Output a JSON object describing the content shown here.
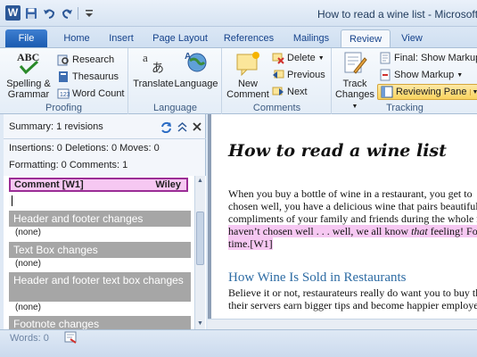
{
  "titlebar": {
    "title": "How to read a wine list - Microsoft W"
  },
  "tabs": [
    "File",
    "Home",
    "Insert",
    "Page Layout",
    "References",
    "Mailings",
    "Review",
    "View"
  ],
  "ribbon": {
    "proofing": {
      "label": "Proofing",
      "spelling": "Spelling & Grammar",
      "research": "Research",
      "thesaurus": "Thesaurus",
      "word_count": "Word Count"
    },
    "language": {
      "label": "Language",
      "translate": "Translate",
      "language": "Language"
    },
    "comments": {
      "label": "Comments",
      "new_comment": "New Comment",
      "delete": "Delete",
      "previous": "Previous",
      "next": "Next"
    },
    "tracking": {
      "label": "Tracking",
      "track_changes": "Track Changes",
      "final_markup": "Final: Show Markup",
      "show_markup": "Show Markup",
      "reviewing_pane": "Reviewing Pane"
    }
  },
  "summary": {
    "title": "Summary: 1 revisions",
    "line1": "Insertions: 0  Deletions: 0  Moves: 0",
    "line2": "Formatting: 0  Comments: 1",
    "comment_label": "Comment [W1]",
    "comment_author": "Wiley",
    "sections": [
      {
        "title": "Header and footer changes",
        "value": "(none)"
      },
      {
        "title": "Text Box changes",
        "value": "(none)"
      },
      {
        "title": "Header and footer text box changes",
        "value": "(none)"
      },
      {
        "title": "Footnote changes",
        "value": ""
      }
    ]
  },
  "document": {
    "heading": "How to read a wine list",
    "p1": "When you buy a bottle of wine in a restaurant, you get to",
    "p2": "chosen well, you have a delicious wine that pairs beautifull",
    "p3": "compliments of your family and friends during the whole m",
    "p4a": "haven’t chosen well . . . well, we all know ",
    "p4b": "that",
    "p4c": " feeling! Fortu",
    "p5": "time.",
    "p5mark": "[W1]",
    "subheading": "How Wine Is Sold in Restaurants",
    "p6": "Believe it or not, restaurateurs really do want you to buy th",
    "p7": "their servers earn bigger tips and become happier employed"
  },
  "status": {
    "words": "Words: 0"
  }
}
